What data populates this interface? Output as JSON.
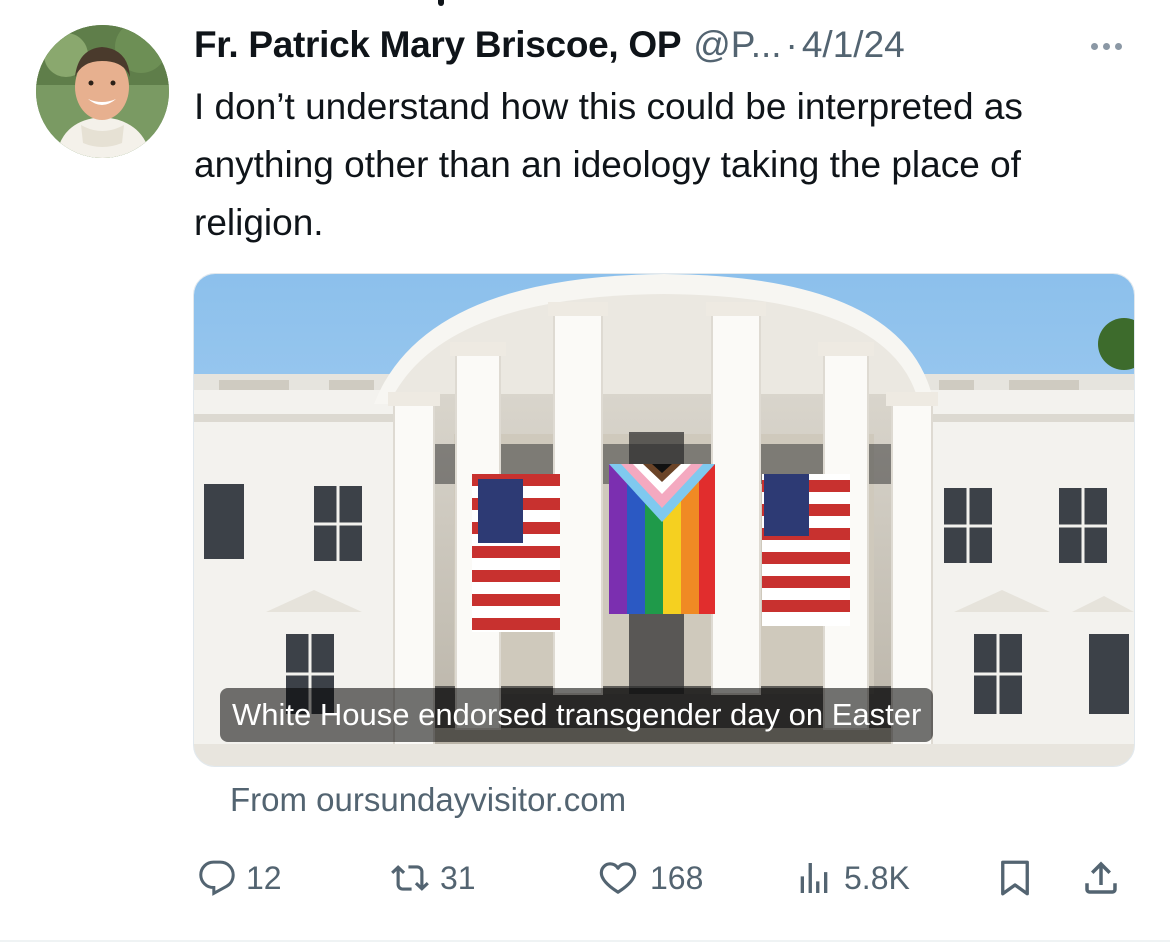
{
  "tweet": {
    "author_name": "Fr. Patrick Mary Briscoe, OP",
    "handle": "@P...",
    "separator": "·",
    "date": "4/1/24",
    "text": "I don’t understand how this could be interpreted as anything other than an ideology taking the place of religion.",
    "more_icon": "more-horizontal-icon"
  },
  "card": {
    "caption": "White House endorsed transgender day on Easter",
    "source": "From oursundayvisitor.com"
  },
  "actions": {
    "reply": {
      "icon": "reply-icon",
      "count": "12"
    },
    "repost": {
      "icon": "repost-icon",
      "count": "31"
    },
    "like": {
      "icon": "heart-icon",
      "count": "168"
    },
    "views": {
      "icon": "views-icon",
      "count": "5.8K"
    },
    "bookmark": {
      "icon": "bookmark-icon"
    },
    "share": {
      "icon": "share-icon"
    }
  },
  "colors": {
    "text": "#0f1419",
    "secondary": "#536471",
    "sky": "#8fc1ec"
  }
}
